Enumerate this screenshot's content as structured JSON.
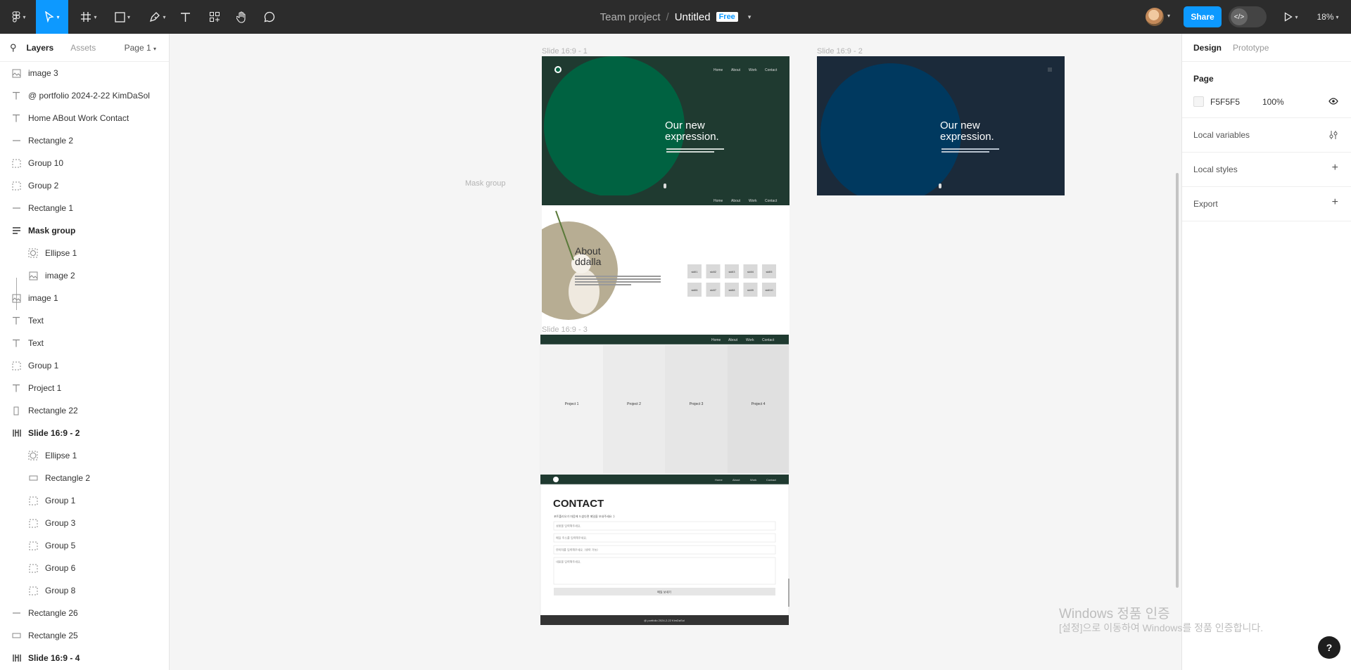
{
  "toolbar": {
    "project": "Team project",
    "separator": "/",
    "file_name": "Untitled",
    "plan_badge": "Free",
    "share": "Share",
    "zoom": "18%"
  },
  "left_panel": {
    "tab_layers": "Layers",
    "tab_assets": "Assets",
    "page_select": "Page 1",
    "layers": [
      {
        "label": "image 3",
        "icon": "image-icon"
      },
      {
        "label": "@ portfolio 2024-2-22 KimDaSol",
        "icon": "text-icon"
      },
      {
        "label": "Home ABout Work Contact",
        "icon": "text-icon"
      },
      {
        "label": "Rectangle 2",
        "icon": "line-icon"
      },
      {
        "label": "Group 10",
        "icon": "group-icon"
      },
      {
        "label": "Group 2",
        "icon": "group-icon"
      },
      {
        "label": "Rectangle 1",
        "icon": "line-icon"
      },
      {
        "label": "Mask group",
        "icon": "mask-icon"
      },
      {
        "label": "Ellipse 1",
        "icon": "ellipse-mask-icon"
      },
      {
        "label": "image 2",
        "icon": "image-icon"
      },
      {
        "label": "image 1",
        "icon": "image-icon"
      },
      {
        "label": "Text",
        "icon": "text-icon"
      },
      {
        "label": "Text",
        "icon": "text-icon"
      },
      {
        "label": "Group 1",
        "icon": "group-icon"
      },
      {
        "label": "Project 1",
        "icon": "text-icon"
      },
      {
        "label": "Rectangle 22",
        "icon": "rect-vertical-icon"
      },
      {
        "label": "Slide 16:9 - 2",
        "icon": "frame-icon"
      },
      {
        "label": "Ellipse 1",
        "icon": "ellipse-icon"
      },
      {
        "label": "Rectangle 2",
        "icon": "rectangle-icon"
      },
      {
        "label": "Group 1",
        "icon": "group-icon"
      },
      {
        "label": "Group 3",
        "icon": "group-icon"
      },
      {
        "label": "Group 5",
        "icon": "group-icon"
      },
      {
        "label": "Group 6",
        "icon": "group-icon"
      },
      {
        "label": "Group 8",
        "icon": "group-icon"
      },
      {
        "label": "Rectangle 26",
        "icon": "line-icon"
      },
      {
        "label": "Rectangle 25",
        "icon": "rectangle-icon"
      },
      {
        "label": "Slide 16:9 - 4",
        "icon": "frame-icon"
      }
    ]
  },
  "right_panel": {
    "tab_design": "Design",
    "tab_prototype": "Prototype",
    "page_heading": "Page",
    "page_color": "F5F5F5",
    "page_opacity": "100%",
    "local_variables": "Local variables",
    "local_styles": "Local styles",
    "export": "Export"
  },
  "canvas": {
    "label_mask_group": "Mask group",
    "slide1": {
      "label": "Slide 16:9 - 1",
      "nav": [
        "Home",
        "About",
        "Work",
        "Contact"
      ],
      "heading": "Our new expression.",
      "colors": {
        "bg": "#1f3a30",
        "circle": "#006241"
      }
    },
    "slide2": {
      "label": "Slide 16:9 - 2",
      "heading": "Our new expression.",
      "colors": {
        "bg": "#1b2a3a",
        "circle": "#00395f"
      }
    },
    "about": {
      "nav": [
        "Home",
        "About",
        "Work",
        "Contact"
      ],
      "title": "About ddalla",
      "skills": [
        "skill1",
        "skill2",
        "skill3",
        "skill4",
        "skill5",
        "skill6",
        "skill7",
        "skill8",
        "skill9",
        "skill10"
      ]
    },
    "projects": {
      "label": "Slide 16:9 - 3",
      "nav": [
        "Home",
        "About",
        "Work",
        "Contact"
      ],
      "items": [
        "Project 1",
        "Project 2",
        "Project 3",
        "Project 4"
      ]
    },
    "contact": {
      "nav": [
        "Home",
        "About",
        "Work",
        "Contact"
      ],
      "title": "CONTACT",
      "subtitle": "포트폴리오가 마음에 드셨다면 메일을 보내주세요 :)",
      "fields": [
        "성함을 입력해주세요.",
        "메일 주소를 입력해주세요.",
        "연락처를 입력해주세요. (생략 가능)",
        "내용을 입력해주세요."
      ],
      "submit": "메일 보내기",
      "footer": "@ portfolio 2024-2-22 KimDaSol"
    }
  },
  "watermark": {
    "line1": "Windows 정품 인증",
    "line2": "[설정]으로 이동하여 Windows를 정품 인증합니다."
  },
  "help": "?"
}
